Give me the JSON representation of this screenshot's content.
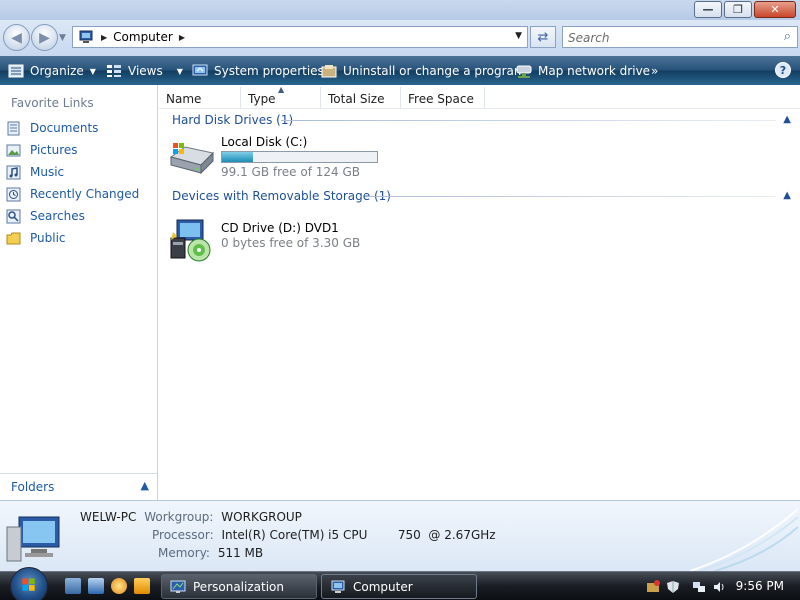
{
  "window": {
    "minimize_label": "—",
    "maximize_label": "❐",
    "close_label": "✕"
  },
  "address": {
    "breadcrumb": "Computer",
    "search_placeholder": "Search"
  },
  "command_bar": {
    "organize": "Organize",
    "views": "Views",
    "system_properties": "System properties",
    "uninstall": "Uninstall or change a program",
    "map_drive": "Map network drive",
    "more": "»",
    "help": "?"
  },
  "nav": {
    "header": "Favorite Links",
    "items": [
      {
        "label": "Documents",
        "icon": "documents-icon"
      },
      {
        "label": "Pictures",
        "icon": "pictures-icon"
      },
      {
        "label": "Music",
        "icon": "music-icon"
      },
      {
        "label": "Recently Changed",
        "icon": "recently-changed-icon"
      },
      {
        "label": "Searches",
        "icon": "searches-icon"
      },
      {
        "label": "Public",
        "icon": "public-folder-icon"
      }
    ],
    "folders_label": "Folders"
  },
  "columns": [
    "Name",
    "Type",
    "Total Size",
    "Free Space"
  ],
  "groups": [
    {
      "title": "Hard Disk Drives (1)",
      "drives": [
        {
          "name": "Local Disk (C:)",
          "free": "99.1 GB free of 124 GB",
          "used_fraction": 0.2,
          "icon": "hard-disk-icon"
        }
      ]
    },
    {
      "title": "Devices with Removable Storage (1)",
      "drives": [
        {
          "name": "CD Drive (D:) DVD1",
          "free": "0 bytes free of 3.30 GB",
          "icon": "cd-drive-icon"
        }
      ]
    }
  ],
  "details": {
    "computer_name": "WELW-PC",
    "workgroup_label": "Workgroup:",
    "workgroup": "WORKGROUP",
    "processor_label": "Processor:",
    "processor": "Intel(R) Core(TM) i5 CPU        750  @ 2.67GHz",
    "memory_label": "Memory:",
    "memory": "511 MB"
  },
  "taskbar": {
    "tasks": [
      {
        "label": "Personalization",
        "active": false
      },
      {
        "label": "Computer",
        "active": true
      }
    ],
    "clock": "9:56 PM"
  },
  "colors": {
    "link": "#1d5aa6",
    "group_header": "#1d4f99",
    "command_bar": "#27527a"
  }
}
